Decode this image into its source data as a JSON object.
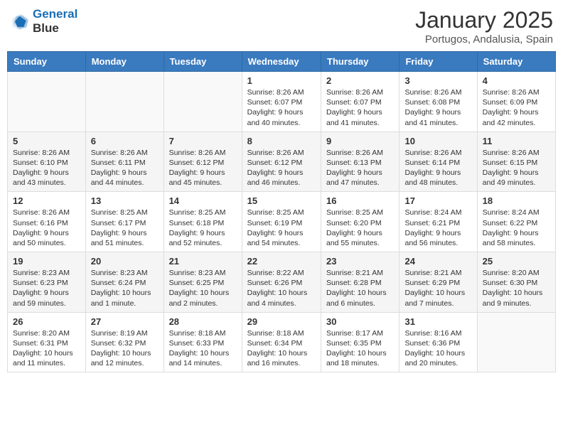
{
  "logo": {
    "line1": "General",
    "line2": "Blue"
  },
  "title": "January 2025",
  "location": "Portugos, Andalusia, Spain",
  "days_of_week": [
    "Sunday",
    "Monday",
    "Tuesday",
    "Wednesday",
    "Thursday",
    "Friday",
    "Saturday"
  ],
  "weeks": [
    [
      {
        "day": "",
        "info": ""
      },
      {
        "day": "",
        "info": ""
      },
      {
        "day": "",
        "info": ""
      },
      {
        "day": "1",
        "info": "Sunrise: 8:26 AM\nSunset: 6:07 PM\nDaylight: 9 hours\nand 40 minutes."
      },
      {
        "day": "2",
        "info": "Sunrise: 8:26 AM\nSunset: 6:07 PM\nDaylight: 9 hours\nand 41 minutes."
      },
      {
        "day": "3",
        "info": "Sunrise: 8:26 AM\nSunset: 6:08 PM\nDaylight: 9 hours\nand 41 minutes."
      },
      {
        "day": "4",
        "info": "Sunrise: 8:26 AM\nSunset: 6:09 PM\nDaylight: 9 hours\nand 42 minutes."
      }
    ],
    [
      {
        "day": "5",
        "info": "Sunrise: 8:26 AM\nSunset: 6:10 PM\nDaylight: 9 hours\nand 43 minutes."
      },
      {
        "day": "6",
        "info": "Sunrise: 8:26 AM\nSunset: 6:11 PM\nDaylight: 9 hours\nand 44 minutes."
      },
      {
        "day": "7",
        "info": "Sunrise: 8:26 AM\nSunset: 6:12 PM\nDaylight: 9 hours\nand 45 minutes."
      },
      {
        "day": "8",
        "info": "Sunrise: 8:26 AM\nSunset: 6:12 PM\nDaylight: 9 hours\nand 46 minutes."
      },
      {
        "day": "9",
        "info": "Sunrise: 8:26 AM\nSunset: 6:13 PM\nDaylight: 9 hours\nand 47 minutes."
      },
      {
        "day": "10",
        "info": "Sunrise: 8:26 AM\nSunset: 6:14 PM\nDaylight: 9 hours\nand 48 minutes."
      },
      {
        "day": "11",
        "info": "Sunrise: 8:26 AM\nSunset: 6:15 PM\nDaylight: 9 hours\nand 49 minutes."
      }
    ],
    [
      {
        "day": "12",
        "info": "Sunrise: 8:26 AM\nSunset: 6:16 PM\nDaylight: 9 hours\nand 50 minutes."
      },
      {
        "day": "13",
        "info": "Sunrise: 8:25 AM\nSunset: 6:17 PM\nDaylight: 9 hours\nand 51 minutes."
      },
      {
        "day": "14",
        "info": "Sunrise: 8:25 AM\nSunset: 6:18 PM\nDaylight: 9 hours\nand 52 minutes."
      },
      {
        "day": "15",
        "info": "Sunrise: 8:25 AM\nSunset: 6:19 PM\nDaylight: 9 hours\nand 54 minutes."
      },
      {
        "day": "16",
        "info": "Sunrise: 8:25 AM\nSunset: 6:20 PM\nDaylight: 9 hours\nand 55 minutes."
      },
      {
        "day": "17",
        "info": "Sunrise: 8:24 AM\nSunset: 6:21 PM\nDaylight: 9 hours\nand 56 minutes."
      },
      {
        "day": "18",
        "info": "Sunrise: 8:24 AM\nSunset: 6:22 PM\nDaylight: 9 hours\nand 58 minutes."
      }
    ],
    [
      {
        "day": "19",
        "info": "Sunrise: 8:23 AM\nSunset: 6:23 PM\nDaylight: 9 hours\nand 59 minutes."
      },
      {
        "day": "20",
        "info": "Sunrise: 8:23 AM\nSunset: 6:24 PM\nDaylight: 10 hours\nand 1 minute."
      },
      {
        "day": "21",
        "info": "Sunrise: 8:23 AM\nSunset: 6:25 PM\nDaylight: 10 hours\nand 2 minutes."
      },
      {
        "day": "22",
        "info": "Sunrise: 8:22 AM\nSunset: 6:26 PM\nDaylight: 10 hours\nand 4 minutes."
      },
      {
        "day": "23",
        "info": "Sunrise: 8:21 AM\nSunset: 6:28 PM\nDaylight: 10 hours\nand 6 minutes."
      },
      {
        "day": "24",
        "info": "Sunrise: 8:21 AM\nSunset: 6:29 PM\nDaylight: 10 hours\nand 7 minutes."
      },
      {
        "day": "25",
        "info": "Sunrise: 8:20 AM\nSunset: 6:30 PM\nDaylight: 10 hours\nand 9 minutes."
      }
    ],
    [
      {
        "day": "26",
        "info": "Sunrise: 8:20 AM\nSunset: 6:31 PM\nDaylight: 10 hours\nand 11 minutes."
      },
      {
        "day": "27",
        "info": "Sunrise: 8:19 AM\nSunset: 6:32 PM\nDaylight: 10 hours\nand 12 minutes."
      },
      {
        "day": "28",
        "info": "Sunrise: 8:18 AM\nSunset: 6:33 PM\nDaylight: 10 hours\nand 14 minutes."
      },
      {
        "day": "29",
        "info": "Sunrise: 8:18 AM\nSunset: 6:34 PM\nDaylight: 10 hours\nand 16 minutes."
      },
      {
        "day": "30",
        "info": "Sunrise: 8:17 AM\nSunset: 6:35 PM\nDaylight: 10 hours\nand 18 minutes."
      },
      {
        "day": "31",
        "info": "Sunrise: 8:16 AM\nSunset: 6:36 PM\nDaylight: 10 hours\nand 20 minutes."
      },
      {
        "day": "",
        "info": ""
      }
    ]
  ]
}
